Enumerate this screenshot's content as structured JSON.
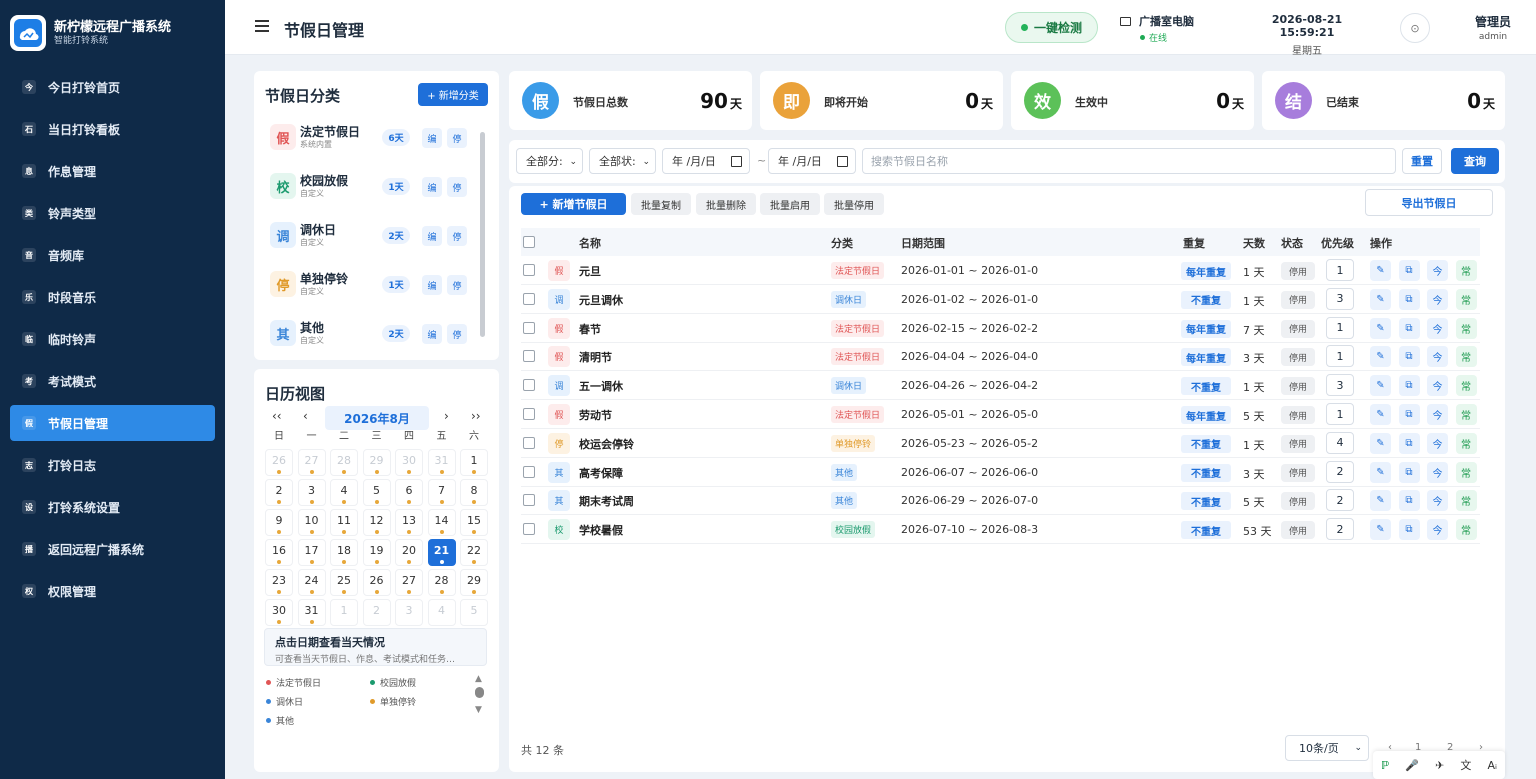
{
  "app": {
    "title": "新柠檬远程广播系统",
    "subtitle": "智能打铃系统"
  },
  "sidebar": {
    "items": [
      {
        "icon": "今",
        "label": "今日打铃首页"
      },
      {
        "icon": "石",
        "label": "当日打铃看板"
      },
      {
        "icon": "息",
        "label": "作息管理"
      },
      {
        "icon": "类",
        "label": "铃声类型"
      },
      {
        "icon": "音",
        "label": "音频库"
      },
      {
        "icon": "乐",
        "label": "时段音乐"
      },
      {
        "icon": "临",
        "label": "临时铃声"
      },
      {
        "icon": "考",
        "label": "考试模式"
      },
      {
        "icon": "假",
        "label": "节假日管理",
        "active": true
      },
      {
        "icon": "志",
        "label": "打铃日志"
      },
      {
        "icon": "设",
        "label": "打铃系统设置"
      },
      {
        "icon": "播",
        "label": "返回远程广播系统"
      },
      {
        "icon": "权",
        "label": "权限管理"
      }
    ]
  },
  "header": {
    "page_title": "节假日管理",
    "check_label": "一键检测",
    "pc_name": "广播室电脑",
    "pc_status": "在线",
    "datetime": "2026-08-21 15:59:21",
    "weekday": "星期五",
    "settings_icon": "⊙",
    "user_name": "管理员",
    "user_role": "admin"
  },
  "categories": {
    "title": "节假日分类",
    "add_label": "+ 新增分类",
    "edit_label": "编",
    "stop_label": "停",
    "items": [
      {
        "badge": "假",
        "name": "法定节假日",
        "sub": "系统内置",
        "days": "6天",
        "bg": "#fdecec",
        "fg": "#e05555"
      },
      {
        "badge": "校",
        "name": "校园放假",
        "sub": "自定义",
        "days": "1天",
        "bg": "#e4f6ef",
        "fg": "#1b9a6e"
      },
      {
        "badge": "调",
        "name": "调休日",
        "sub": "自定义",
        "days": "2天",
        "bg": "#e6f1fd",
        "fg": "#3a85d8"
      },
      {
        "badge": "停",
        "name": "单独停铃",
        "sub": "自定义",
        "days": "1天",
        "bg": "#fdf2e2",
        "fg": "#e09a2a"
      },
      {
        "badge": "其",
        "name": "其他",
        "sub": "自定义",
        "days": "2天",
        "bg": "#e6f1fd",
        "fg": "#3a85d8"
      }
    ]
  },
  "calendar": {
    "title": "日历视图",
    "prev_year": "‹‹",
    "prev_month": "‹",
    "next_month": "›",
    "next_year": "››",
    "month_label": "2026年8月",
    "weekdays": [
      "日",
      "一",
      "二",
      "三",
      "四",
      "五",
      "六"
    ],
    "days": [
      {
        "d": "26",
        "m": true,
        "dot": true
      },
      {
        "d": "27",
        "m": true,
        "dot": true
      },
      {
        "d": "28",
        "m": true,
        "dot": true
      },
      {
        "d": "29",
        "m": true,
        "dot": true
      },
      {
        "d": "30",
        "m": true,
        "dot": true
      },
      {
        "d": "31",
        "m": true,
        "dot": true
      },
      {
        "d": "1",
        "dot": true
      },
      {
        "d": "2",
        "dot": true
      },
      {
        "d": "3",
        "dot": true
      },
      {
        "d": "4",
        "dot": true
      },
      {
        "d": "5",
        "dot": true
      },
      {
        "d": "6",
        "dot": true
      },
      {
        "d": "7",
        "dot": true
      },
      {
        "d": "8",
        "dot": true
      },
      {
        "d": "9",
        "dot": true
      },
      {
        "d": "10",
        "dot": true
      },
      {
        "d": "11",
        "dot": true
      },
      {
        "d": "12",
        "dot": true
      },
      {
        "d": "13",
        "dot": true
      },
      {
        "d": "14",
        "dot": true
      },
      {
        "d": "15",
        "dot": true
      },
      {
        "d": "16",
        "dot": true
      },
      {
        "d": "17",
        "dot": true
      },
      {
        "d": "18",
        "dot": true
      },
      {
        "d": "19",
        "dot": true
      },
      {
        "d": "20",
        "dot": true
      },
      {
        "d": "21",
        "today": true,
        "dot": true
      },
      {
        "d": "22",
        "dot": true
      },
      {
        "d": "23",
        "dot": true
      },
      {
        "d": "24",
        "dot": true
      },
      {
        "d": "25",
        "dot": true
      },
      {
        "d": "26",
        "dot": true
      },
      {
        "d": "27",
        "dot": true
      },
      {
        "d": "28",
        "dot": true
      },
      {
        "d": "29",
        "dot": true
      },
      {
        "d": "30",
        "dot": true
      },
      {
        "d": "31",
        "dot": true
      },
      {
        "d": "1",
        "m": true
      },
      {
        "d": "2",
        "m": true
      },
      {
        "d": "3",
        "m": true
      },
      {
        "d": "4",
        "m": true
      },
      {
        "d": "5",
        "m": true
      }
    ],
    "hint_title": "点击日期查看当天情况",
    "hint_sub": "可查看当天节假日、作息、考试模式和任务…",
    "legend": [
      {
        "label": "法定节假日",
        "color": "#e05555"
      },
      {
        "label": "校园放假",
        "color": "#1b9a6e"
      },
      {
        "label": "调休日",
        "color": "#3a85d8"
      },
      {
        "label": "单独停铃",
        "color": "#e09a2a"
      },
      {
        "label": "其他",
        "color": "#3a85d8"
      }
    ]
  },
  "stats": [
    {
      "badge": "假",
      "label": "节假日总数",
      "value": "90",
      "unit": "天",
      "color": "#3a9be8"
    },
    {
      "badge": "即",
      "label": "即将开始",
      "value": "0",
      "unit": "天",
      "color": "#eaa23a"
    },
    {
      "badge": "效",
      "label": "生效中",
      "value": "0",
      "unit": "天",
      "color": "#5cc159"
    },
    {
      "badge": "结",
      "label": "已结束",
      "value": "0",
      "unit": "天",
      "color": "#a77ddc"
    }
  ],
  "filters": {
    "category_select": "全部分:",
    "status_select": "全部状:",
    "date_from": "年 /月/日",
    "tilde": "~",
    "date_to": "年 /月/日",
    "search_placeholder": "搜索节假日名称",
    "reset_label": "重置",
    "query_label": "查询"
  },
  "toolbar": {
    "add_label": "+ 新增节假日",
    "batch_copy": "批量复制",
    "batch_delete": "批量删除",
    "batch_enable": "批量启用",
    "batch_disable": "批量停用",
    "export_label": "导出节假日"
  },
  "table": {
    "headers": {
      "name": "名称",
      "category": "分类",
      "range": "日期范围",
      "repeat": "重复",
      "days": "天数",
      "status": "状态",
      "priority": "优先级",
      "actions": "操作"
    },
    "rows": [
      {
        "badge": "假",
        "name": "元旦",
        "category": "法定节假日",
        "range": "2026-01-01 ~ 2026-01-0",
        "repeat": "每年重复",
        "days": "1 天",
        "status": "停用",
        "priority": "1",
        "type": "legal"
      },
      {
        "badge": "调",
        "name": "元旦调休",
        "category": "调休日",
        "range": "2026-01-02 ~ 2026-01-0",
        "repeat": "不重复",
        "days": "1 天",
        "status": "停用",
        "priority": "3",
        "type": "adjust"
      },
      {
        "badge": "假",
        "name": "春节",
        "category": "法定节假日",
        "range": "2026-02-15 ~ 2026-02-2",
        "repeat": "每年重复",
        "days": "7 天",
        "status": "停用",
        "priority": "1",
        "type": "legal"
      },
      {
        "badge": "假",
        "name": "清明节",
        "category": "法定节假日",
        "range": "2026-04-04 ~ 2026-04-0",
        "repeat": "每年重复",
        "days": "3 天",
        "status": "停用",
        "priority": "1",
        "type": "legal"
      },
      {
        "badge": "调",
        "name": "五一调休",
        "category": "调休日",
        "range": "2026-04-26 ~ 2026-04-2",
        "repeat": "不重复",
        "days": "1 天",
        "status": "停用",
        "priority": "3",
        "type": "adjust"
      },
      {
        "badge": "假",
        "name": "劳动节",
        "category": "法定节假日",
        "range": "2026-05-01 ~ 2026-05-0",
        "repeat": "每年重复",
        "days": "5 天",
        "status": "停用",
        "priority": "1",
        "type": "legal"
      },
      {
        "badge": "停",
        "name": "校运会停铃",
        "category": "单独停铃",
        "range": "2026-05-23 ~ 2026-05-2",
        "repeat": "不重复",
        "days": "1 天",
        "status": "停用",
        "priority": "4",
        "type": "stop"
      },
      {
        "badge": "其",
        "name": "高考保障",
        "category": "其他",
        "range": "2026-06-07 ~ 2026-06-0",
        "repeat": "不重复",
        "days": "3 天",
        "status": "停用",
        "priority": "2",
        "type": "other"
      },
      {
        "badge": "其",
        "name": "期末考试周",
        "category": "其他",
        "range": "2026-06-29 ~ 2026-07-0",
        "repeat": "不重复",
        "days": "5 天",
        "status": "停用",
        "priority": "2",
        "type": "other"
      },
      {
        "badge": "校",
        "name": "学校暑假",
        "category": "校园放假",
        "range": "2026-07-10 ~ 2026-08-3",
        "repeat": "不重复",
        "days": "53 天",
        "status": "停用",
        "priority": "2",
        "type": "campus"
      }
    ],
    "op_icons": [
      "✎",
      "⧉",
      "今",
      "常"
    ]
  },
  "footer": {
    "total": "共 12 条",
    "page_size": "10条/页",
    "prev": "‹",
    "page1": "1",
    "page2": "2",
    "next": "›"
  },
  "floatbar": [
    "ℙ",
    "🎤",
    "✈",
    "文",
    "Aᵢ"
  ]
}
